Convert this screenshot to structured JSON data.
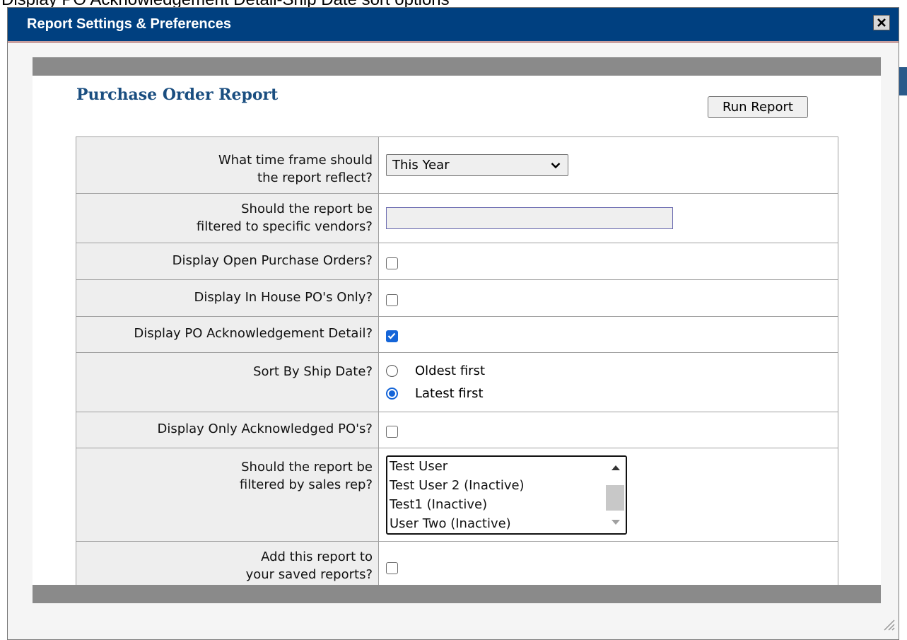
{
  "page_caption": "Display PO Acknowledgement Detail-Ship Date sort options",
  "dialog": {
    "title": "Report Settings & Preferences",
    "close_icon": "close-icon"
  },
  "report": {
    "title": "Purchase Order Report",
    "run_button_label": "Run Report"
  },
  "settings": {
    "time_frame": {
      "label_line1": "What time frame should",
      "label_line2": "the report reflect?",
      "selected": "This Year"
    },
    "vendor_filter": {
      "label_line1": "Should the report be",
      "label_line2": "filtered to specific vendors?",
      "value": ""
    },
    "open_pos": {
      "label": "Display Open Purchase Orders?",
      "checked": false
    },
    "in_house": {
      "label": "Display In House PO's Only?",
      "checked": false
    },
    "ack_detail": {
      "label": "Display PO Acknowledgement Detail?",
      "checked": true
    },
    "sort_ship_date": {
      "label": "Sort By Ship Date?",
      "options": [
        "Oldest first",
        "Latest first"
      ],
      "selected": "Latest first"
    },
    "only_acknowledged": {
      "label": "Display Only Acknowledged PO's?",
      "checked": false
    },
    "sales_rep": {
      "label_line1": "Should the report be",
      "label_line2": "filtered by sales rep?",
      "options": [
        "Test User",
        "Test User 2 (Inactive)",
        "Test1 (Inactive)",
        "User Two (Inactive)"
      ]
    },
    "save_report": {
      "label_line1": "Add this report to",
      "label_line2": "your saved reports?",
      "checked": false
    }
  },
  "colors": {
    "titlebar": "#004080",
    "report_title": "#1a4e80",
    "checkbox_checked": "#1565d8",
    "panel_bar": "#8a8a8a"
  }
}
